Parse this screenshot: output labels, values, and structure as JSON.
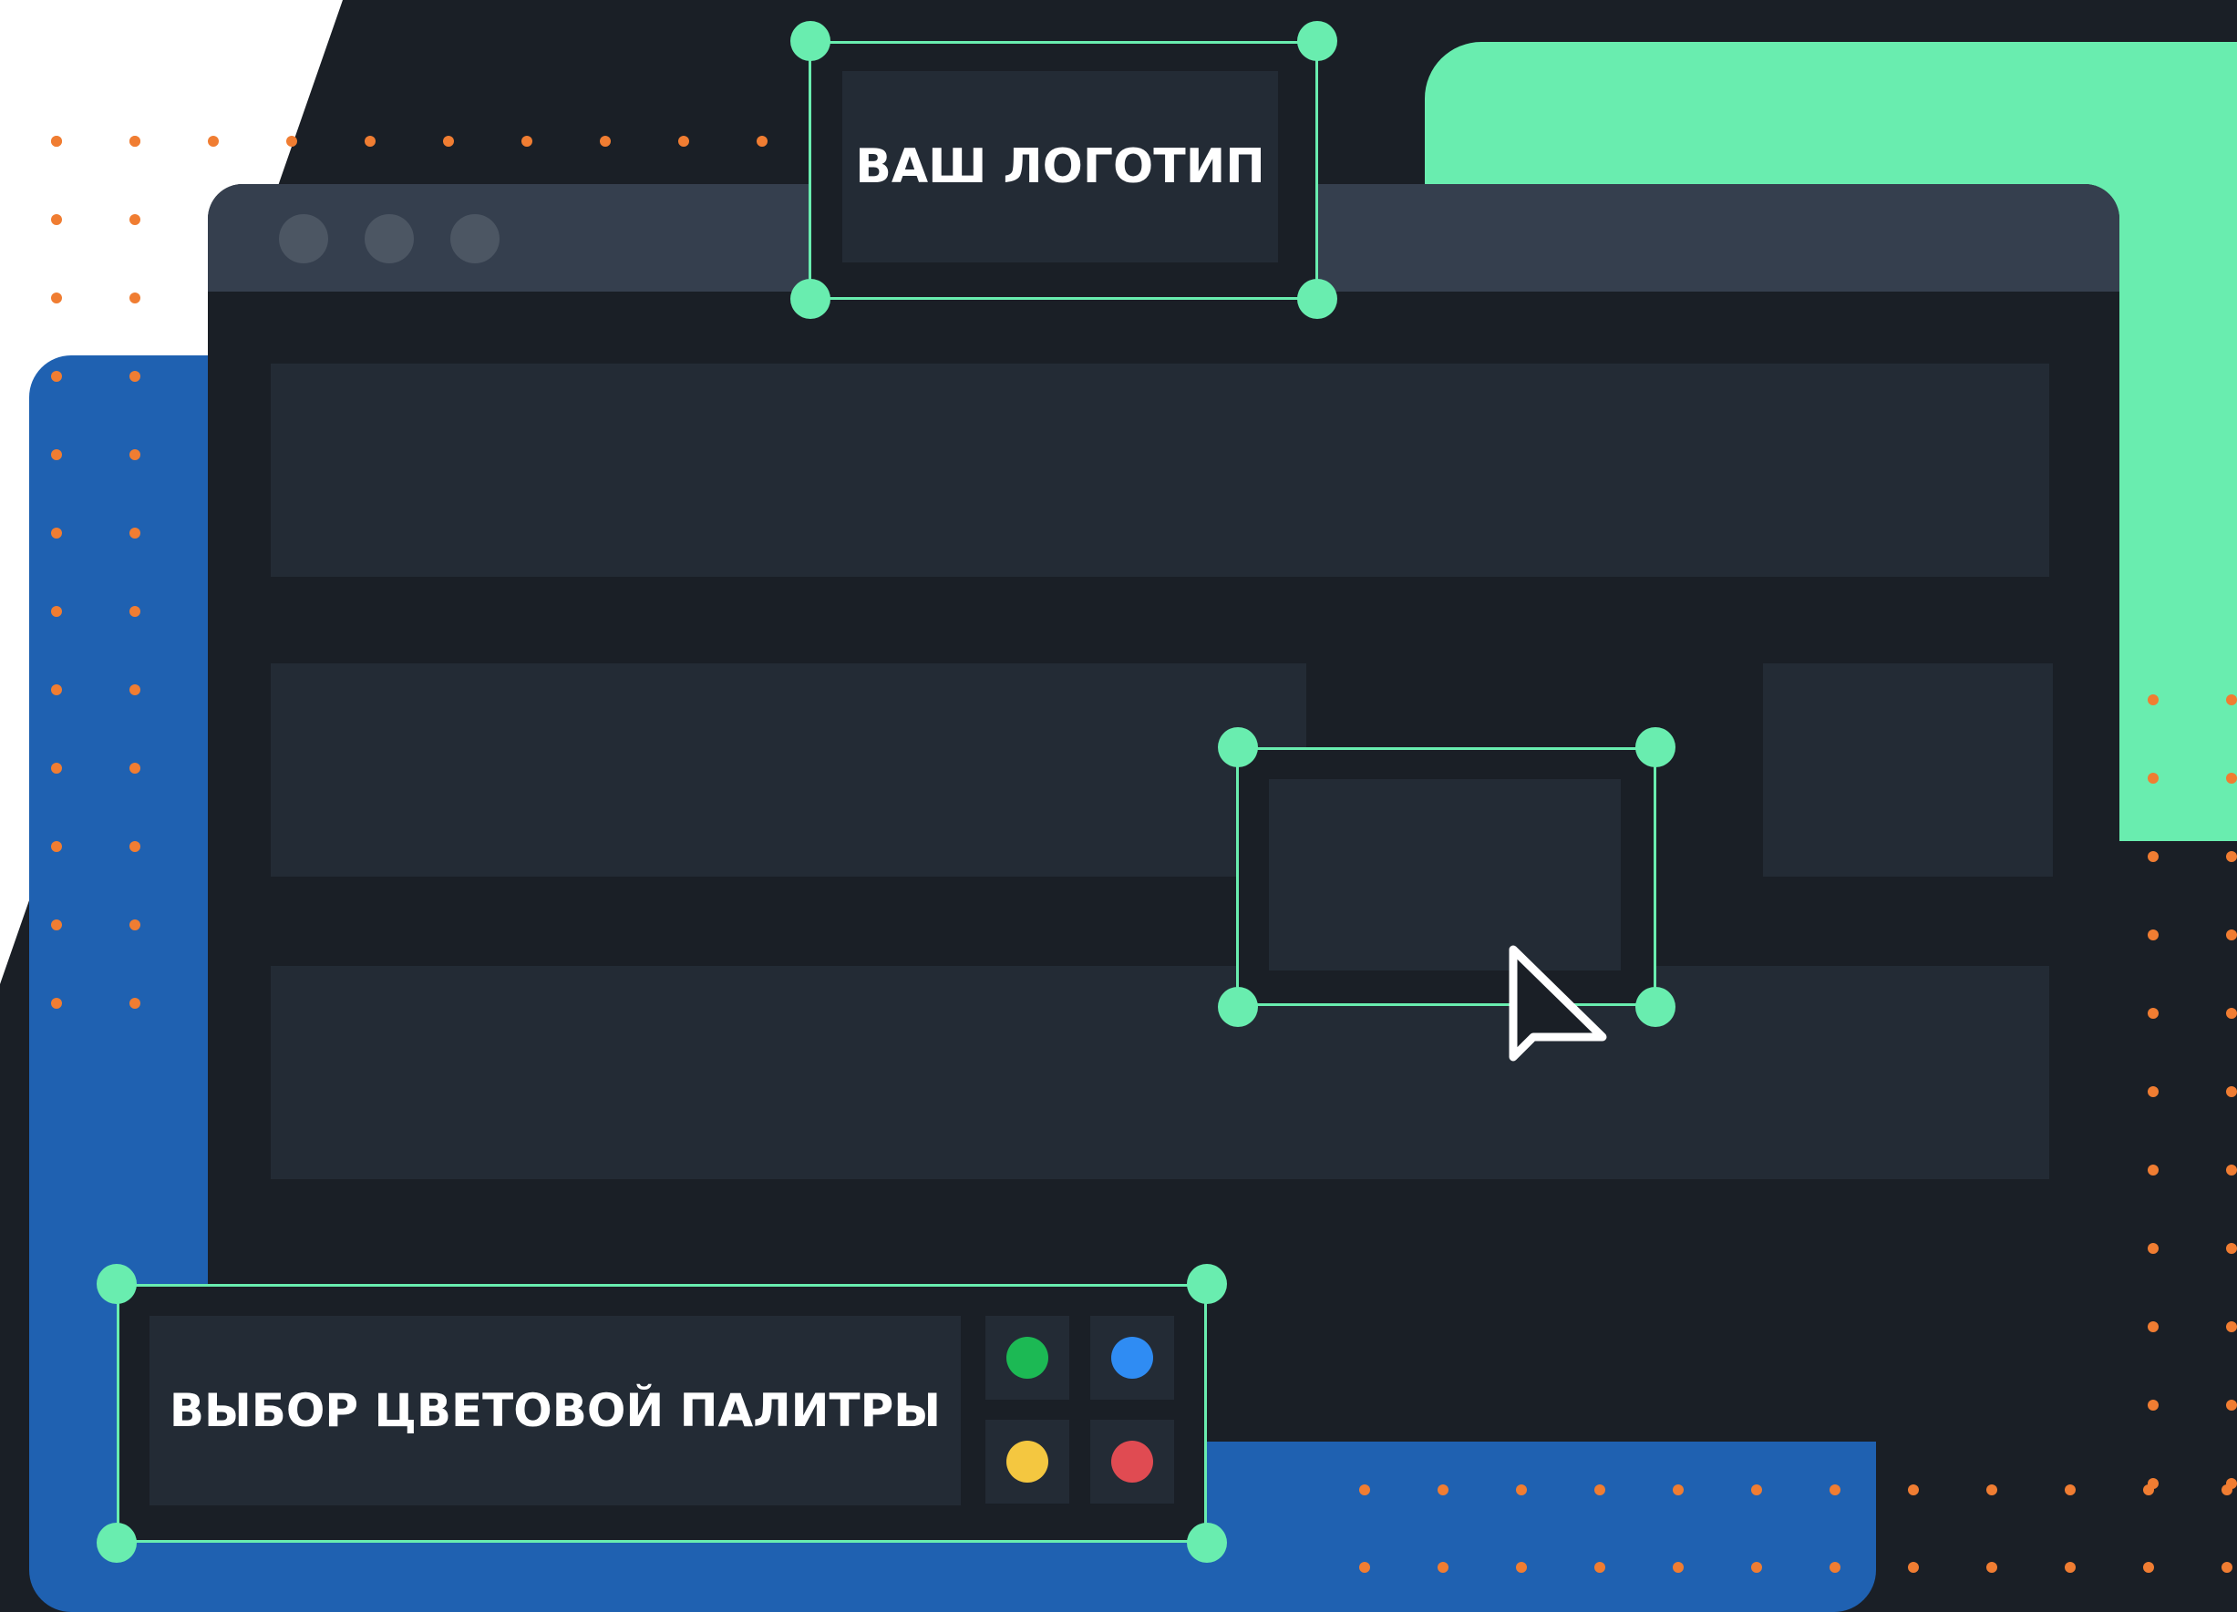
{
  "logo_placeholder": {
    "label": "ВАШ ЛОГОТИП"
  },
  "palette_picker": {
    "label": "ВЫБОР ЦВЕТОВОЙ ПАЛИТРЫ",
    "swatches": [
      {
        "name": "green",
        "color": "#1cb954"
      },
      {
        "name": "blue",
        "color": "#2f8cf3"
      },
      {
        "name": "yellow",
        "color": "#f4c740"
      },
      {
        "name": "red",
        "color": "#e04b52"
      }
    ]
  },
  "colors": {
    "accent_green": "#69edaf",
    "blue_panel": "#1f61b1",
    "dark_background": "#1a1f26",
    "content_block": "#232b35",
    "titlebar": "#353f4e",
    "orange_dots": "#f07d32"
  },
  "icons": [
    "window-control-icon",
    "mouse-pointer-icon",
    "selection-handle-icon"
  ]
}
